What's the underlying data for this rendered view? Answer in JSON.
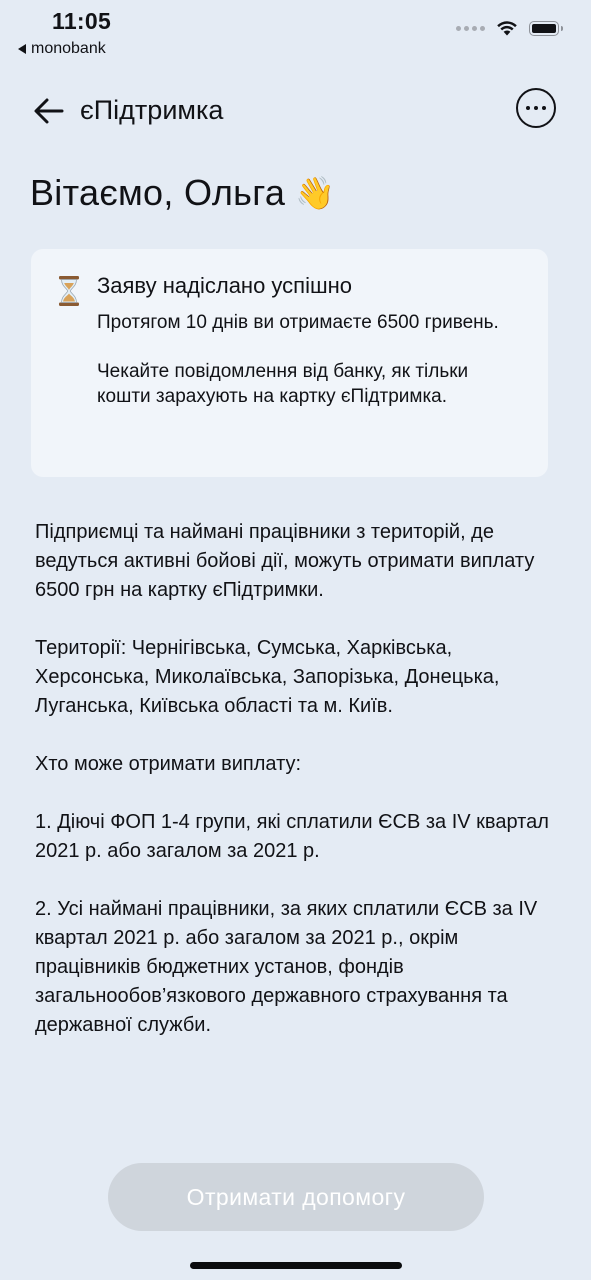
{
  "status_bar": {
    "time": "11:05",
    "back_app_label": "monobank"
  },
  "nav": {
    "title": "єПідтримка",
    "back_icon": "arrow-left-icon",
    "more_icon": "more-horizontal-icon"
  },
  "greeting": {
    "text": "Вітаємо, Ольга",
    "emoji": "👋"
  },
  "status_card": {
    "icon": "hourglass-icon",
    "title": "Заяву надіслано успішно",
    "paragraphs": [
      "Протягом 10 днів ви отримаєте 6500 гривень.",
      "Чекайте повідомлення від банку, як тільки кошти зарахують на картку єПідтримка."
    ]
  },
  "info": {
    "paragraphs": [
      "Підприємці та наймані працівники з територій, де ведуться активні бойові дії, можуть отримати виплату 6500 грн на картку єПідтримки.",
      "Території: Чернігівська, Сумська, Харківська, Херсонська, Миколаївська, Запорізька, Донецька, Луганська, Київська області та м. Київ.",
      "Хто може отримати виплату:",
      "1. Діючі ФОП 1-4 групи, які сплатили ЄСВ за IV квартал 2021 р. або загалом за 2021 р.",
      "2. Усі наймані працівники, за яких сплатили ЄСВ за IV квартал 2021 р. або загалом за 2021 р., окрім працівників бюджетних установ, фондів загальнообов’язкового державного страхування  та державної служби."
    ]
  },
  "cta": {
    "label": "Отримати допомогу",
    "enabled": false
  },
  "colors": {
    "background": "#e4ebf4",
    "card": "#f1f5fa",
    "text": "#111216",
    "button_disabled": "#cfd5dc"
  }
}
